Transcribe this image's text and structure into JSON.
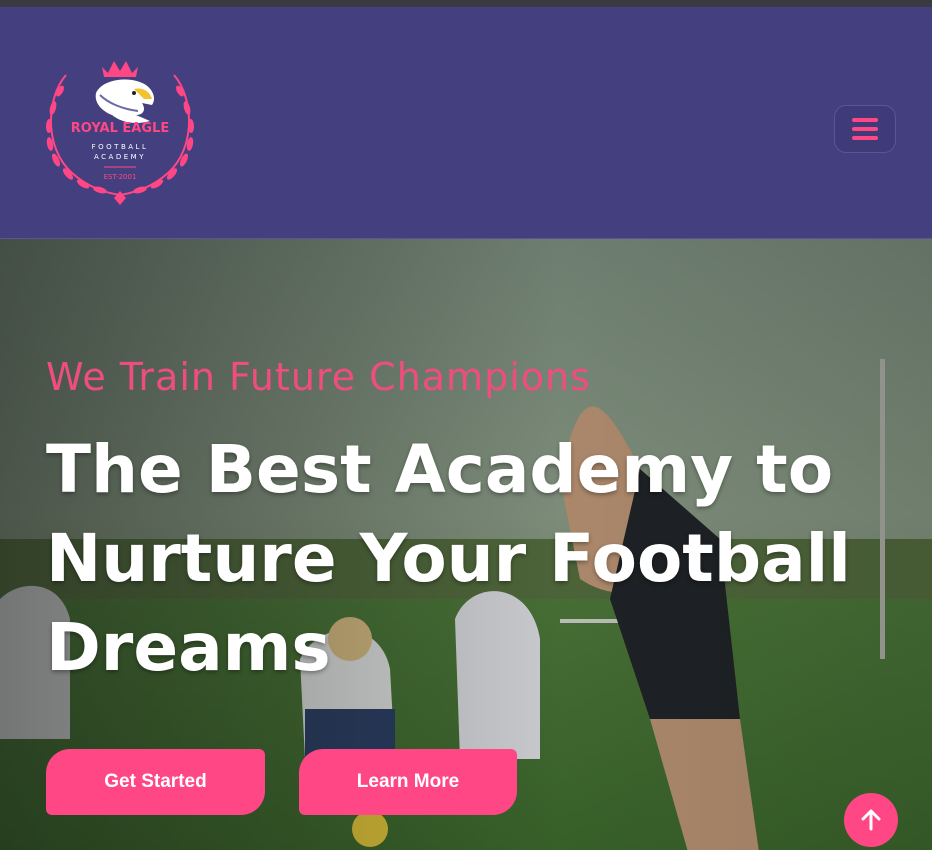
{
  "brand": {
    "name": "ROYAL EAGLE",
    "line1": "FOOTBALL",
    "line2": "ACADEMY",
    "est": "EST-2001"
  },
  "nav": {
    "menu_icon": "hamburger-icon"
  },
  "hero": {
    "tagline": "We Train Future Champions",
    "headline": "The Best Academy to Nurture Your Football Dreams",
    "primary_button": "Get Started",
    "secondary_button": "Learn More"
  },
  "scroll_top": {
    "icon": "arrow-up-icon"
  },
  "colors": {
    "header_bg": "#443f7e",
    "accent": "#ff4785",
    "tagline": "#f04d7f",
    "headline": "#ffffff"
  }
}
